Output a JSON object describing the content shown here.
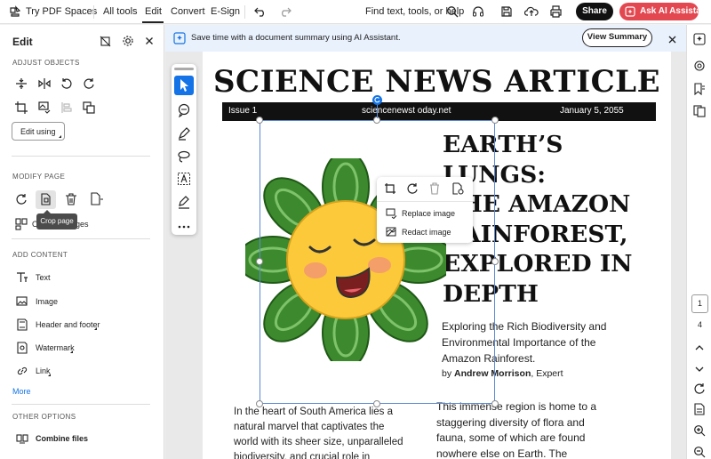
{
  "topbar": {
    "app_title": "Try PDF Spaces",
    "menus": [
      "All tools",
      "Edit",
      "Convert",
      "E-Sign"
    ],
    "search_label": "Find text, tools, or help",
    "share_label": "Share",
    "ai_label": "Ask AI Assistant"
  },
  "left_panel": {
    "title": "Edit",
    "adjust_section": "ADJUST OBJECTS",
    "edit_using": "Edit using",
    "modify_section": "MODIFY PAGE",
    "tooltip": "Crop page",
    "organize_label": "Organize pages",
    "add_section": "ADD CONTENT",
    "add_items": [
      "Text",
      "Image",
      "Header and footer",
      "Watermark",
      "Link"
    ],
    "more": "More",
    "other_section": "OTHER OPTIONS",
    "combine": "Combine files"
  },
  "banner": {
    "text": "Save time with a document summary using AI Assistant.",
    "button": "View Summary"
  },
  "context_menu": {
    "replace": "Replace image",
    "redact": "Redact image"
  },
  "article": {
    "masthead": "SCIENCE NEWS ARTICLE",
    "issue": "Issue 1",
    "site": "sciencenewst oday.net",
    "date": "January 5, 2055",
    "headline_lines": [
      "EARTH’S",
      "LUNGS:",
      "THE AMAZON",
      "RAINFOREST,",
      "EXPLORED IN",
      "DEPTH"
    ],
    "subtitle_lines": [
      "Exploring the Rich Biodiversity and",
      "Environmental Importance of the",
      "Amazon Rainforest."
    ],
    "byline_prefix": "by ",
    "author": "Andrew Morrison",
    "author_role": ", Expert",
    "body_left": [
      "In the heart of South America lies a",
      "natural marvel that captivates the",
      "world with its sheer size, unparalleled",
      "biodiversity, and crucial role in"
    ],
    "body_right": [
      "This immense region is home to a",
      "staggering diversity of flora and",
      "fauna, some of which are found",
      "nowhere else on Earth. The"
    ]
  },
  "right_rail": {
    "current_page": "1",
    "total_pages": "4"
  },
  "colors": {
    "accent_blue": "#1473e6",
    "ai_red": "#e34850",
    "masthead_bar": "#111111",
    "selection": "#5a8ad6",
    "petal_green": "#3d8a2e",
    "face_yellow": "#fbc93a"
  }
}
